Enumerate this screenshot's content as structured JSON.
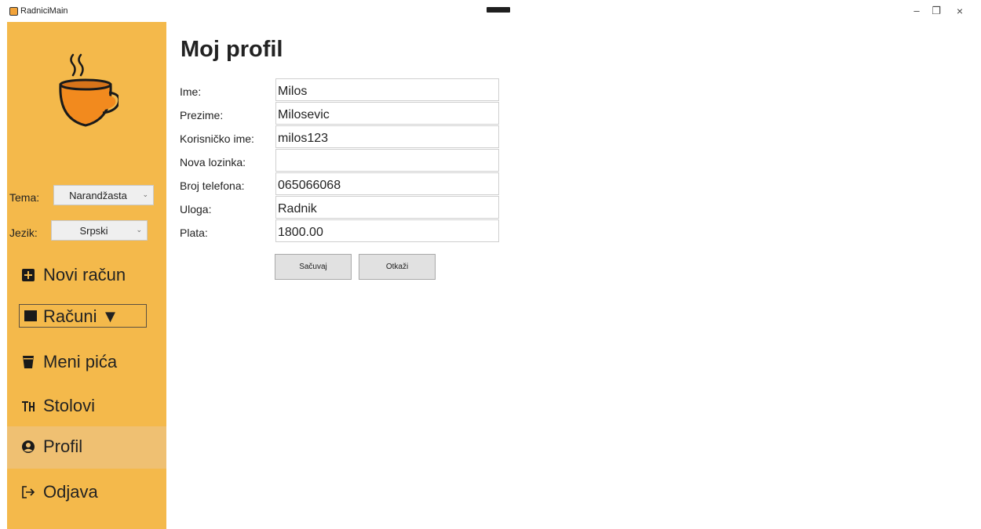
{
  "window": {
    "title": "RadniciMain",
    "min": "–",
    "max": "❐",
    "close": "×"
  },
  "sidebar": {
    "theme_label": "Tema:",
    "theme_value": "Narandžasta",
    "lang_label": "Jezik:",
    "lang_value": "Srpski",
    "nav": [
      {
        "label": "Novi račun",
        "icon": "plus-square-icon"
      },
      {
        "label": "Računi ▼",
        "icon": "receipt-icon"
      },
      {
        "label": "Meni pića",
        "icon": "glass-icon"
      },
      {
        "label": "Stolovi",
        "icon": "table-icon"
      },
      {
        "label": "Profil",
        "icon": "user-circle-icon"
      },
      {
        "label": "Odjava",
        "icon": "logout-icon"
      }
    ],
    "active": "Profil",
    "colors": {
      "sidebar": "#f4b94b",
      "active": "#efc072",
      "cup": "#f28a1e"
    }
  },
  "main": {
    "title": "Moj profil",
    "fields": [
      {
        "label": "Ime:",
        "value": "Milos"
      },
      {
        "label": "Prezime:",
        "value": "Milosevic"
      },
      {
        "label": "Korisničko ime:",
        "value": "milos123"
      },
      {
        "label": "Nova lozinka:",
        "value": ""
      },
      {
        "label": "Broj telefona:",
        "value": "065066068"
      },
      {
        "label": "Uloga:",
        "value": "Radnik"
      },
      {
        "label": "Plata:",
        "value": "1800.00"
      }
    ],
    "save_label": "Sačuvaj",
    "cancel_label": "Otkaži"
  }
}
